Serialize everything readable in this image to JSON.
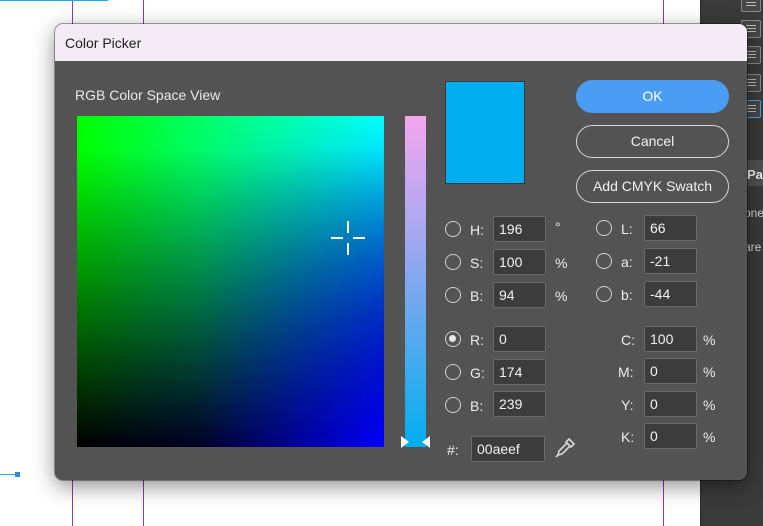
{
  "dialog": {
    "title": "Color Picker",
    "view_label": "RGB Color Space View"
  },
  "selected_color": "#00aeef",
  "buttons": {
    "ok": "OK",
    "cancel": "Cancel",
    "add_swatch": "Add CMYK Swatch"
  },
  "hsb": {
    "h": {
      "label": "H:",
      "value": "196",
      "unit": "°"
    },
    "s": {
      "label": "S:",
      "value": "100",
      "unit": "%"
    },
    "b": {
      "label": "B:",
      "value": "94",
      "unit": "%"
    }
  },
  "lab": {
    "l": {
      "label": "L:",
      "value": "66"
    },
    "a": {
      "label": "a:",
      "value": "-21"
    },
    "b": {
      "label": "b:",
      "value": "-44"
    }
  },
  "rgb": {
    "selected": "R",
    "r": {
      "label": "R:",
      "value": "0"
    },
    "g": {
      "label": "G:",
      "value": "174"
    },
    "b": {
      "label": "B:",
      "value": "239"
    }
  },
  "cmyk": {
    "c": {
      "label": "C:",
      "value": "100",
      "unit": "%"
    },
    "m": {
      "label": "M:",
      "value": "0",
      "unit": "%"
    },
    "y": {
      "label": "Y:",
      "value": "0",
      "unit": "%"
    },
    "k": {
      "label": "K:",
      "value": "0",
      "unit": "%"
    }
  },
  "hex": {
    "label": "#:",
    "value": "00aeef"
  },
  "background": {
    "panel_tab": "Pa",
    "panel_text_1": "one",
    "panel_text_2": "are"
  }
}
